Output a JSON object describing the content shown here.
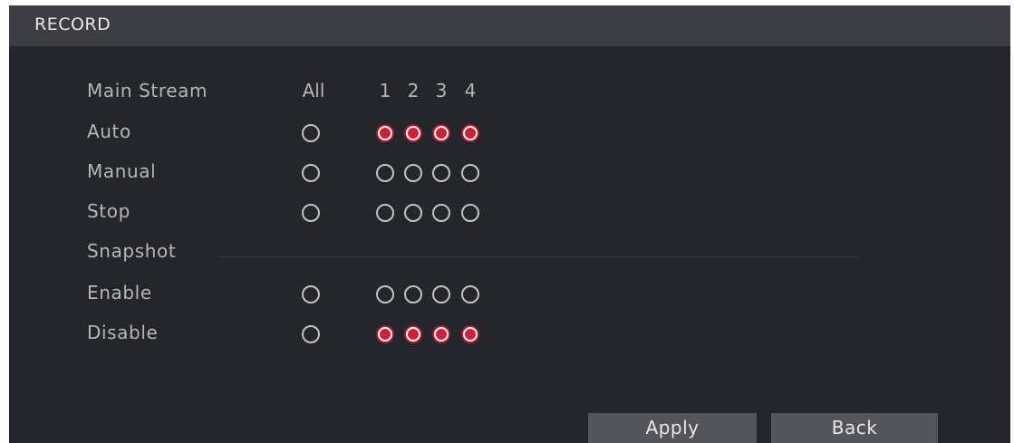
{
  "window": {
    "title": "RECORD"
  },
  "columns": {
    "label": "Main Stream",
    "all": "All",
    "channels": [
      "1",
      "2",
      "3",
      "4"
    ]
  },
  "record": {
    "auto": {
      "label": "Auto",
      "all": false,
      "channels": [
        true,
        true,
        true,
        true
      ]
    },
    "manual": {
      "label": "Manual",
      "all": false,
      "channels": [
        false,
        false,
        false,
        false
      ]
    },
    "stop": {
      "label": "Stop",
      "all": false,
      "channels": [
        false,
        false,
        false,
        false
      ]
    }
  },
  "snapshot": {
    "label": "Snapshot",
    "enable": {
      "label": "Enable",
      "all": false,
      "channels": [
        false,
        false,
        false,
        false
      ]
    },
    "disable": {
      "label": "Disable",
      "all": false,
      "channels": [
        true,
        true,
        true,
        true
      ]
    }
  },
  "buttons": {
    "apply": "Apply",
    "back": "Back"
  },
  "colors": {
    "selected": "#d21f35",
    "background": "#25262c",
    "titlebar": "#3c3e44"
  }
}
